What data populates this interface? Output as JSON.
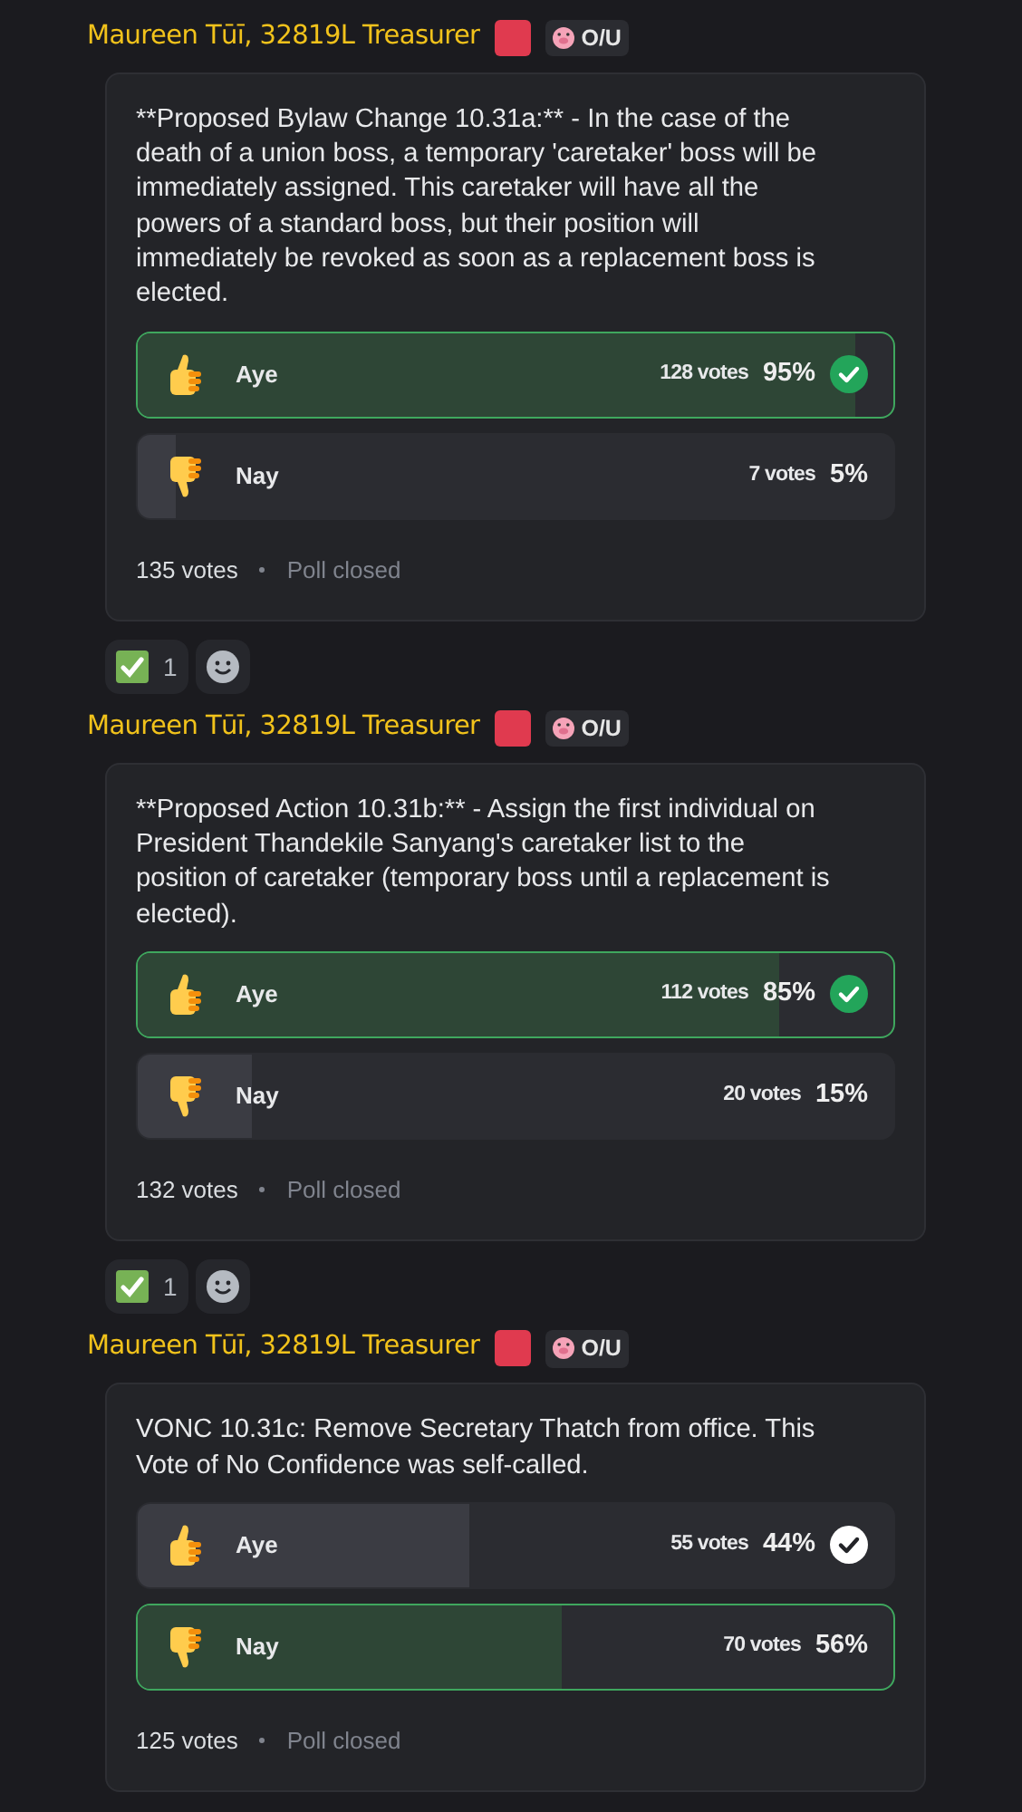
{
  "messages": [
    {
      "author": "Maureen Tūī, 32819L Treasurer",
      "tag": "O/U",
      "poll": {
        "question": "**Proposed Bylaw Change 10.31a:** - In the case of the death of a union boss, a temporary 'caretaker' boss will be immediately assigned. This caretaker will have all the powers of a standard boss, but their position will immediately be revoked as soon as a replacement boss is elected.",
        "options": [
          {
            "kind": "up",
            "label": "Aye",
            "votes": "128 votes",
            "percent": "95%",
            "level": 0.95,
            "winner": true,
            "voted": true
          },
          {
            "kind": "down",
            "label": "Nay",
            "votes": "7 votes",
            "percent": "5%",
            "level": 0.05,
            "winner": false,
            "voted": false
          }
        ],
        "total": "135 votes",
        "status": "Poll closed"
      },
      "reactions": [
        {
          "count": "1"
        }
      ]
    },
    {
      "author": "Maureen Tūī, 32819L Treasurer",
      "tag": "O/U",
      "poll": {
        "question": "**Proposed Action 10.31b:** - Assign the first individual on President Thandekile Sanyang's caretaker list to the position of caretaker (temporary boss until a replacement is elected).",
        "options": [
          {
            "kind": "up",
            "label": "Aye",
            "votes": "112 votes",
            "percent": "85%",
            "level": 0.85,
            "winner": true,
            "voted": true
          },
          {
            "kind": "down",
            "label": "Nay",
            "votes": "20 votes",
            "percent": "15%",
            "level": 0.15,
            "winner": false,
            "voted": false
          }
        ],
        "total": "132 votes",
        "status": "Poll closed"
      },
      "reactions": [
        {
          "count": "1"
        }
      ]
    },
    {
      "author": "Maureen Tūī, 32819L Treasurer",
      "tag": "O/U",
      "poll": {
        "question": "VONC 10.31c: Remove Secretary Thatch from office. This Vote of No Confidence was self-called.",
        "options": [
          {
            "kind": "up",
            "label": "Aye",
            "votes": "55 votes",
            "percent": "44%",
            "level": 0.44,
            "winner": false,
            "voted": true
          },
          {
            "kind": "down",
            "label": "Nay",
            "votes": "70 votes",
            "percent": "56%",
            "level": 0.56,
            "winner": true,
            "voted": false
          }
        ],
        "total": "125 votes",
        "status": "Poll closed"
      }
    }
  ]
}
